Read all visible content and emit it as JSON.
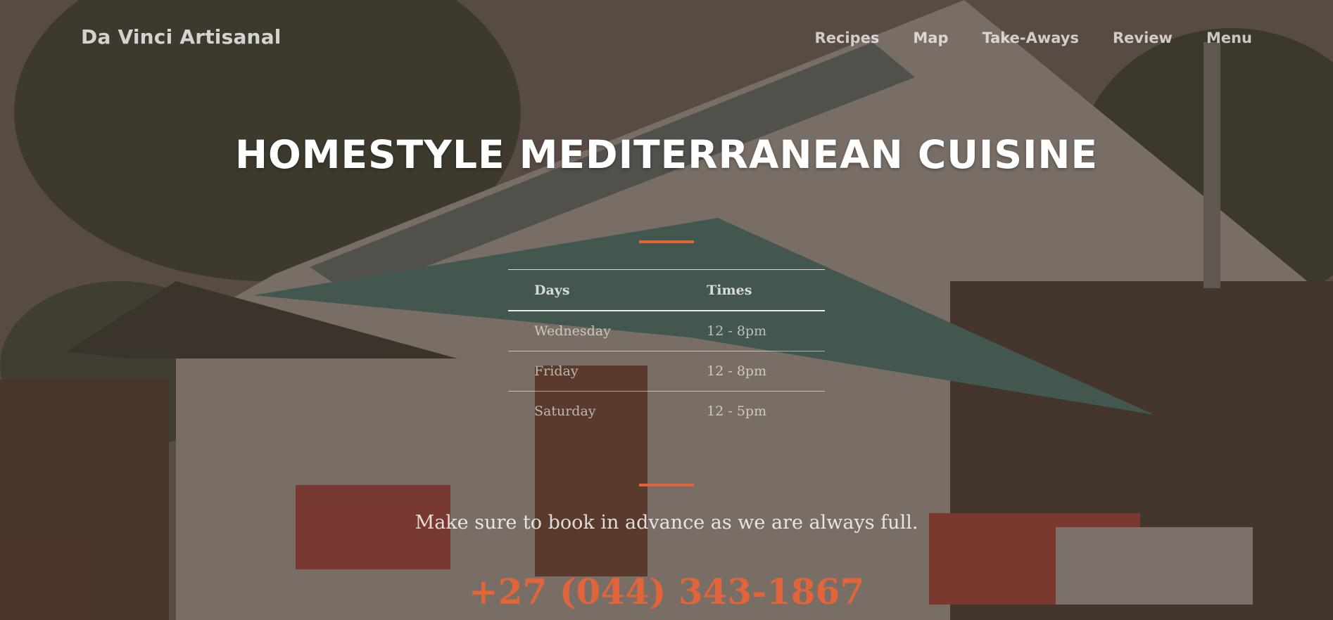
{
  "brand": {
    "name": "Da Vinci Artisanal"
  },
  "nav": {
    "items": [
      {
        "label": "Recipes"
      },
      {
        "label": "Map"
      },
      {
        "label": "Take-Aways"
      },
      {
        "label": "Review"
      },
      {
        "label": "Menu"
      }
    ]
  },
  "hero": {
    "title": "HOMESTYLE MEDITERRANEAN CUISINE"
  },
  "hours": {
    "headers": {
      "days": "Days",
      "times": "Times"
    },
    "rows": [
      {
        "day": "Wednesday",
        "time": "12 - 8pm"
      },
      {
        "day": "Friday",
        "time": "12 - 8pm"
      },
      {
        "day": "Saturday",
        "time": "12 - 5pm"
      }
    ]
  },
  "booking": {
    "note": "Make sure to book in advance as we are always full.",
    "phone": "+27 (044) 343-1867"
  },
  "colors": {
    "accent": "#e2643a",
    "overlay": "#3c2d26"
  },
  "icons": {}
}
